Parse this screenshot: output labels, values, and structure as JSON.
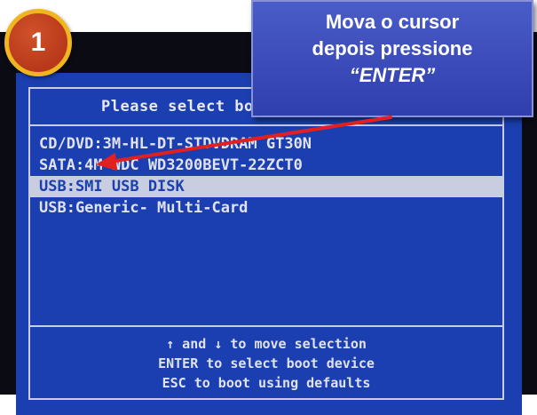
{
  "boot_menu": {
    "title": "Please select boot device:",
    "devices": [
      "CD/DVD:3M-HL-DT-STDVDRAM GT30N",
      "SATA:4M-WDC WD3200BEVT-22ZCT0",
      "USB:SMI USB DISK",
      "USB:Generic- Multi-Card"
    ],
    "selected_index": 2,
    "footer": [
      "↑ and ↓ to move selection",
      "ENTER to select boot device",
      "ESC to boot using defaults"
    ]
  },
  "annotation": {
    "step_number": "1",
    "callout_line1": "Mova o cursor",
    "callout_line2": "depois pressione",
    "callout_line3": "“ENTER”"
  },
  "colors": {
    "screen_blue": "#1b3fb0",
    "highlight": "#c9cde0",
    "callout_blue": "#3a4cbc",
    "badge_red": "#c0441f",
    "badge_ring": "#f0b61f",
    "arrow_red": "#e32020"
  },
  "icons": [
    "up-arrow-icon",
    "down-arrow-icon"
  ]
}
